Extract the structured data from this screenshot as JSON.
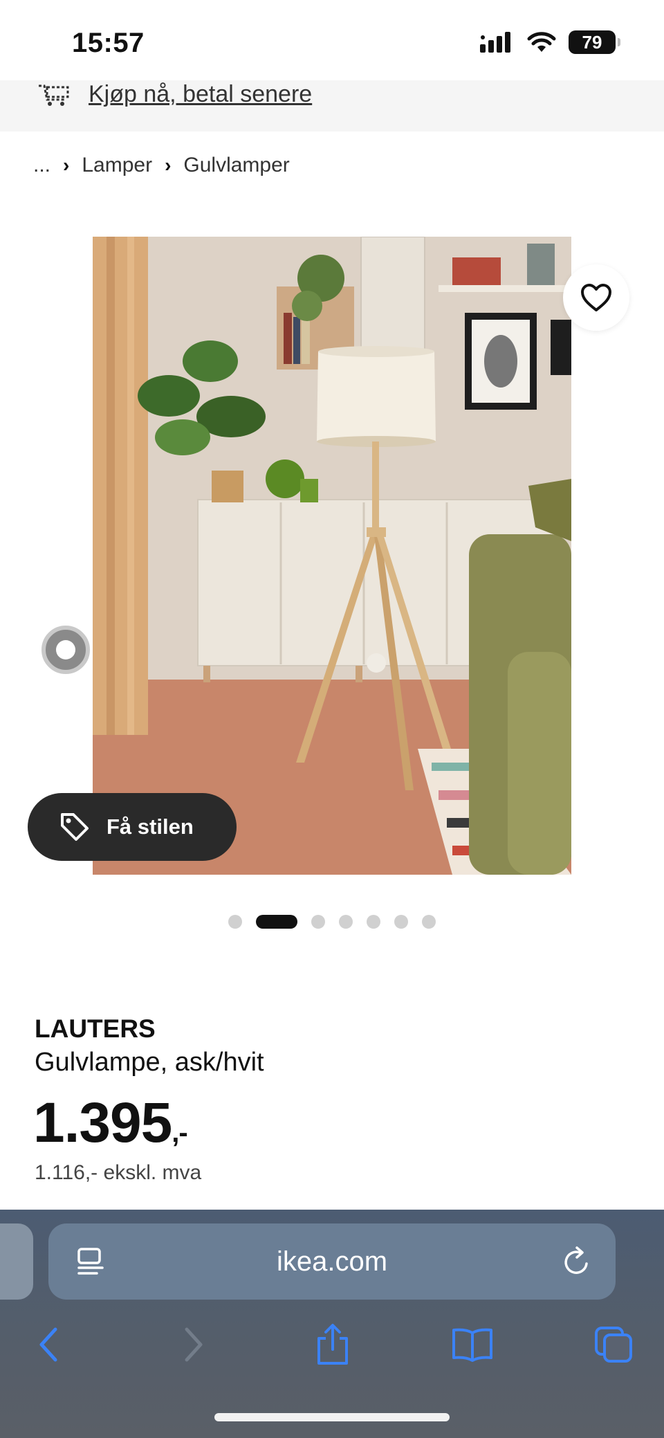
{
  "status": {
    "time": "15:57",
    "battery": "79"
  },
  "promo": {
    "text": "Kjøp nå, betal senere",
    "icon": "shopping-cart-dotted-icon"
  },
  "breadcrumb": {
    "ellipsis": "...",
    "items": [
      "Lamper",
      "Gulvlamper"
    ]
  },
  "gallery": {
    "style_button_label": "Få stilen",
    "dots_total": 7,
    "active_dot": 2
  },
  "product": {
    "name": "LAUTERS",
    "description": "Gulvlampe, ask/hvit",
    "price_main": "1.395",
    "price_suffix": ",-",
    "price_ex_vat": "1.116,- ekskl. mva"
  },
  "browser": {
    "url": "ikea.com"
  },
  "colors": {
    "accent_ios_blue": "#3b82f6",
    "dark_button": "#2a2a2a"
  }
}
